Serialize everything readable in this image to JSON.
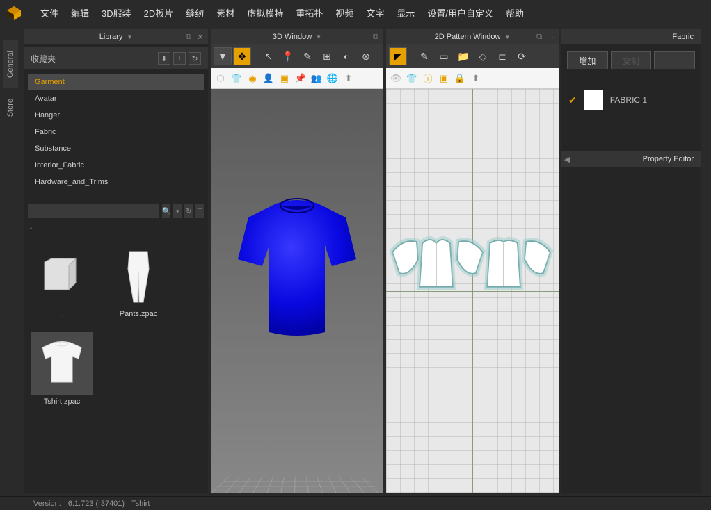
{
  "menu": {
    "items": [
      "文件",
      "编辑",
      "3D服装",
      "2D板片",
      "缝纫",
      "素材",
      "虚拟模特",
      "重拓扑",
      "视频",
      "文字",
      "显示",
      "设置/用户自定义",
      "帮助"
    ]
  },
  "side_tabs": {
    "general": "General",
    "store": "Store"
  },
  "library": {
    "title": "Library",
    "favorites_label": "收藏夹",
    "categories": [
      {
        "name": "Garment",
        "selected": true
      },
      {
        "name": "Avatar",
        "selected": false
      },
      {
        "name": "Hanger",
        "selected": false
      },
      {
        "name": "Fabric",
        "selected": false
      },
      {
        "name": "Substance",
        "selected": false
      },
      {
        "name": "Interior_Fabric",
        "selected": false
      },
      {
        "name": "Hardware_and_Trims",
        "selected": false
      }
    ],
    "path_dot": "..",
    "files": [
      {
        "name": "..",
        "type": "folder"
      },
      {
        "name": "Pants.zpac",
        "type": "pants"
      },
      {
        "name": "Tshirt.zpac",
        "type": "tshirt",
        "selected": true
      }
    ]
  },
  "window_3d": {
    "title": "3D Window"
  },
  "window_2d": {
    "title": "2D Pattern Window"
  },
  "fabric": {
    "title": "Fabric",
    "add_btn": "增加",
    "copy_btn": "复制",
    "third_btn": "",
    "items": [
      {
        "name": "FABRIC 1",
        "checked": true
      }
    ]
  },
  "property_editor": {
    "title": "Property Editor"
  },
  "statusbar": {
    "version_label": "Version:",
    "version": "6.1.723 (r37401)",
    "file": "Tshirt"
  }
}
